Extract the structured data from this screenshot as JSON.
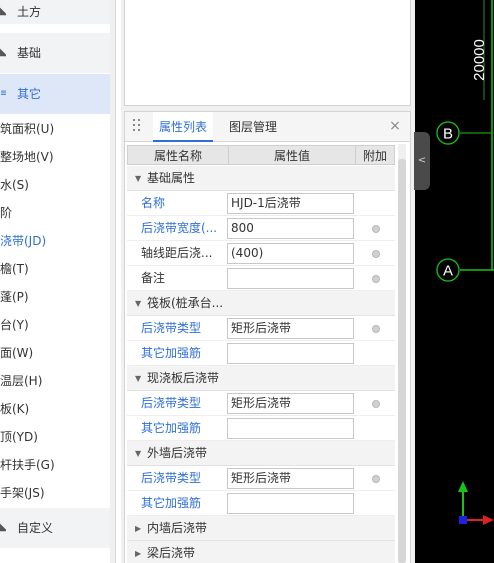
{
  "sidebar": {
    "categories": [
      {
        "label": "土方",
        "icon": "earthwork-icon"
      },
      {
        "label": "基础",
        "icon": "foundation-icon"
      },
      {
        "label": "其它",
        "icon": "list-icon"
      }
    ],
    "items": [
      "筑面积(U)",
      "整场地(V)",
      "水(S)",
      "阶",
      "浇带(JD)",
      "檐(T)",
      "蓬(P)",
      "台(Y)",
      "面(W)",
      "温层(H)",
      "板(K)",
      "顶(YD)",
      "杆扶手(G)",
      "手架(JS)"
    ],
    "custom_label": "自定义"
  },
  "panel": {
    "tabs": {
      "properties": "属性列表",
      "layers": "图层管理"
    },
    "close_symbol": "×",
    "columns": {
      "name": "属性名称",
      "value": "属性值",
      "extra": "附加"
    },
    "groups": {
      "basic": "基础属性",
      "raft": "筏板(桩承台...",
      "cast_slab": "现浇板后浇带",
      "outer_wall": "外墙后浇带",
      "inner_wall": "内墙后浇带",
      "beam": "梁后浇带"
    },
    "basic_rows": [
      {
        "name": "名称",
        "value": "HJD-1后浇带"
      },
      {
        "name": "后浇带宽度(...",
        "value": "800"
      },
      {
        "name": "轴线距后浇...",
        "value": "(400)"
      },
      {
        "name": "备注",
        "value": ""
      }
    ],
    "raft_rows": [
      {
        "name": "后浇带类型",
        "value": "矩形后浇带"
      },
      {
        "name": "其它加强筋",
        "value": ""
      }
    ],
    "cast_slab_rows": [
      {
        "name": "后浇带类型",
        "value": "矩形后浇带"
      },
      {
        "name": "其它加强筋",
        "value": ""
      }
    ],
    "outer_wall_rows": [
      {
        "name": "后浇带类型",
        "value": "矩形后浇带"
      },
      {
        "name": "其它加强筋",
        "value": ""
      }
    ]
  },
  "canvas": {
    "dimension": "20000",
    "axis_b": "B",
    "axis_a": "A"
  },
  "colors": {
    "accent": "#2f6fd6",
    "canvas_bg": "#000000",
    "axis_green": "#19c319",
    "ucs_red": "#e02020",
    "ucs_blue": "#2020e0"
  }
}
